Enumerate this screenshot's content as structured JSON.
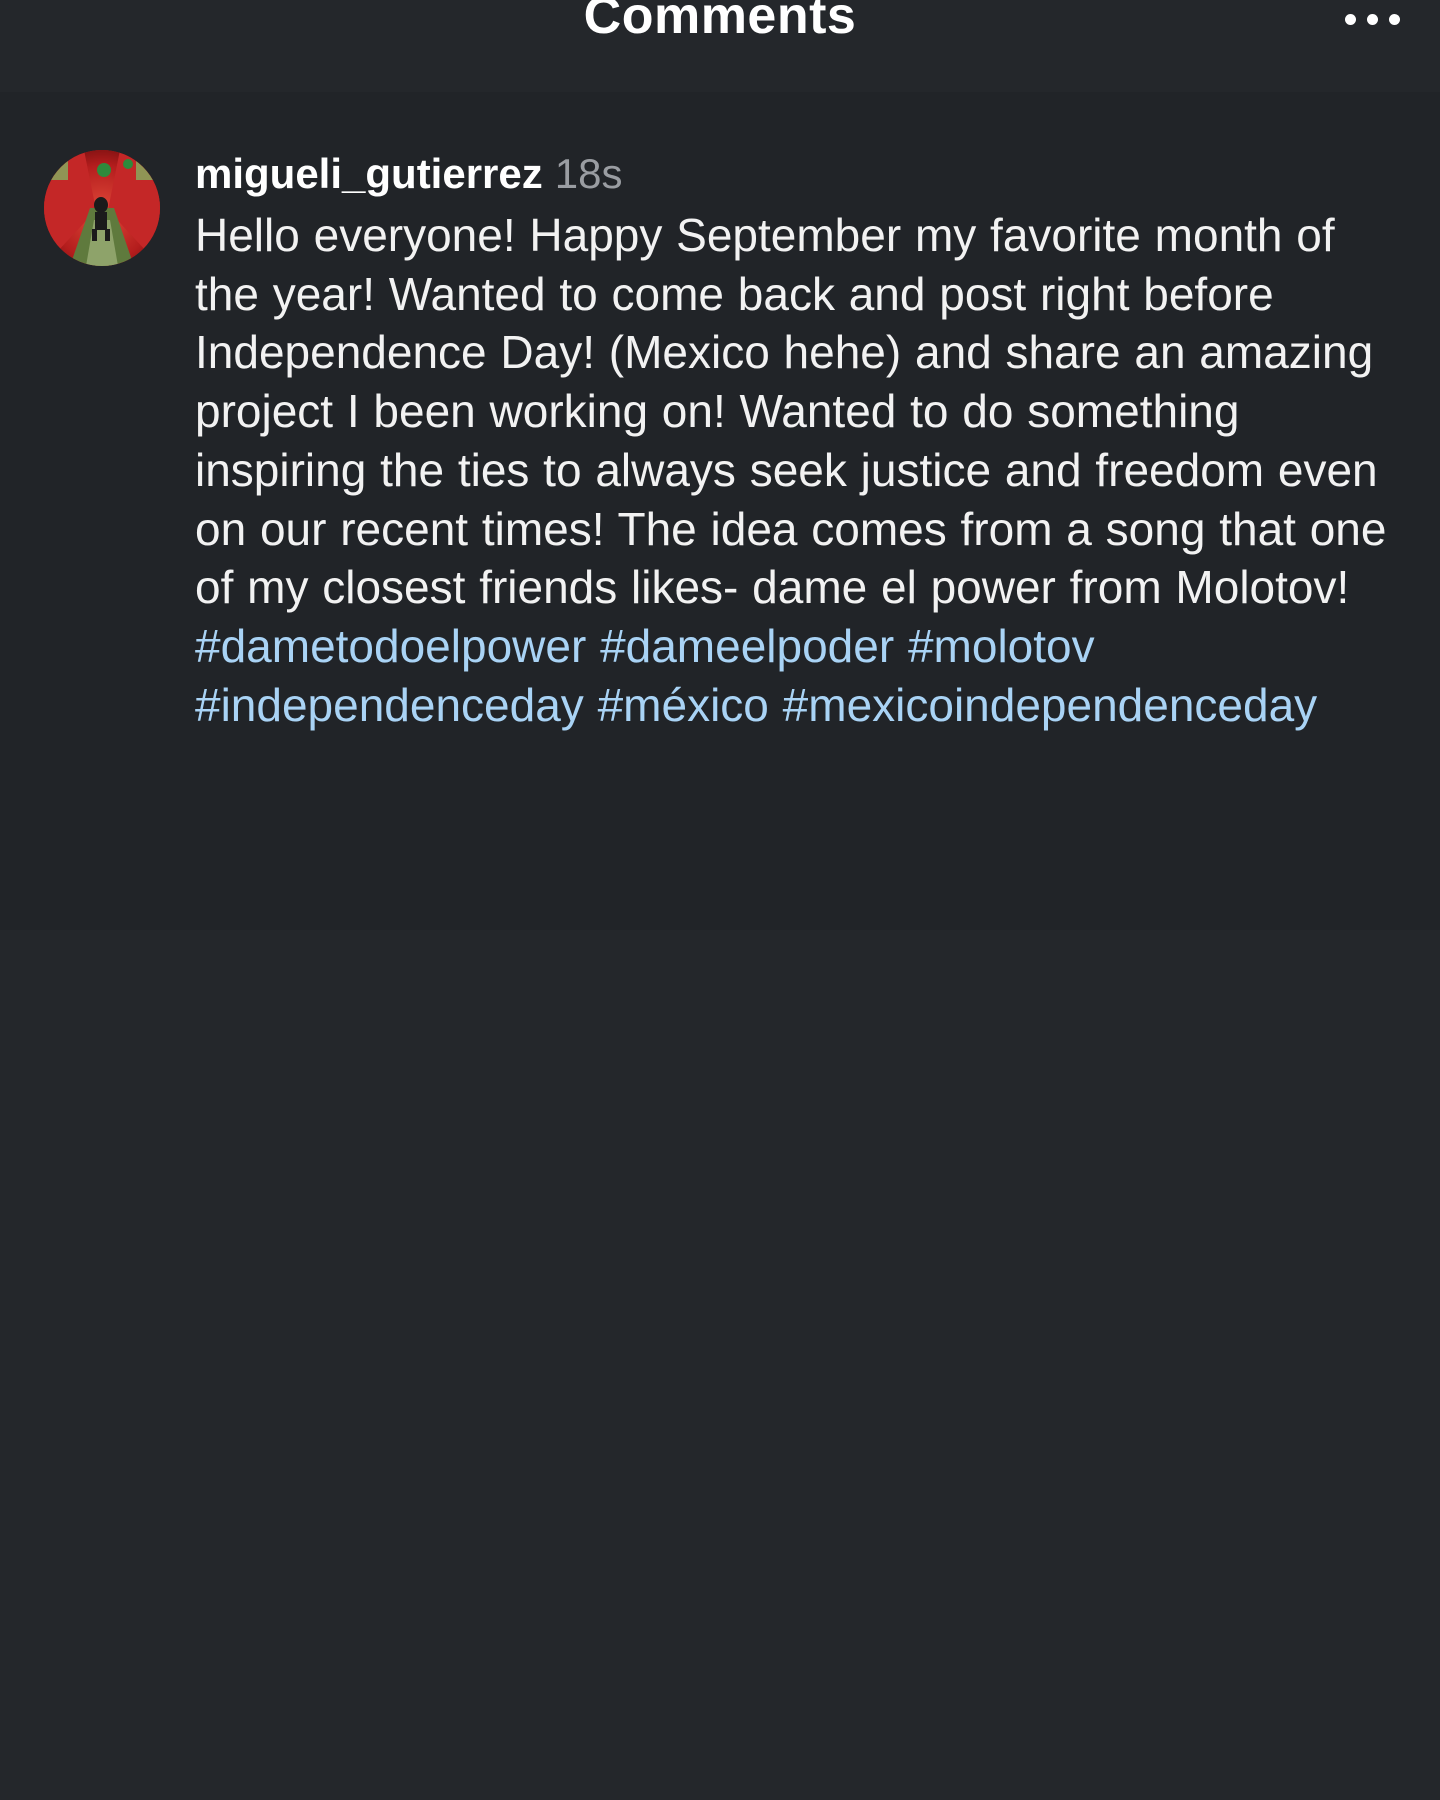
{
  "header": {
    "title": "Comments",
    "more_icon": "more-horizontal-icon"
  },
  "comment": {
    "avatar_icon": "profile-avatar",
    "username": "migueli_gutierrez",
    "timestamp": "18s",
    "text": "Hello everyone! Happy September my favorite month of the year! Wanted to come back and post right before Independence Day! (Mexico hehe) and share an amazing project I been working on! Wanted to do something inspiring the ties to always seek justice and freedom even on our recent times! The idea comes from a song that one of my closest friends likes- dame el power from Molotov!",
    "hashtags": [
      "#dametodoelpower",
      "#dameelpoder",
      "#molotov",
      "#independenceday",
      "#méxico",
      "#mexicoindependenceday"
    ]
  },
  "colors": {
    "background": "#24272b",
    "comment_background": "#212428",
    "hashtag": "#a9d3f5",
    "timestamp": "#9a9da2"
  }
}
